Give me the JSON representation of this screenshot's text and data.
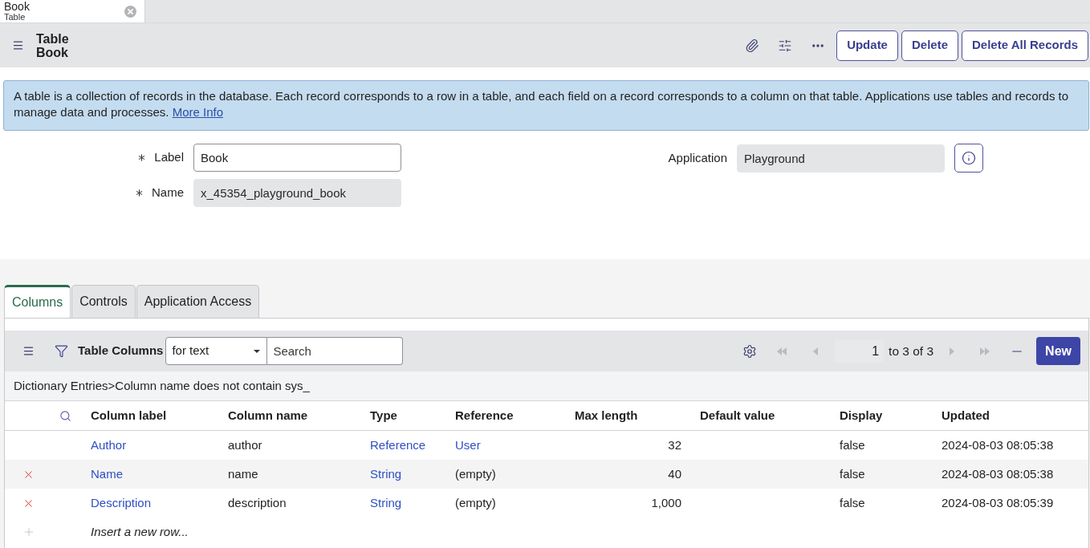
{
  "browser_tabs": [
    {
      "title": "Book",
      "subtitle": "Table",
      "selected": true
    }
  ],
  "header": {
    "title": "Table",
    "subtitle": "Book",
    "buttons": [
      "Update",
      "Delete",
      "Delete All Records"
    ]
  },
  "info_banner": {
    "text": "A table is a collection of records in the database. Each record corresponds to a row in a table, and each field on a record corresponds to a column on that table. Applications use tables and records to manage data and processes.",
    "link": "More Info"
  },
  "form": {
    "left_fields": [
      {
        "label": "Label",
        "required": true,
        "value": "Book",
        "readonly": false
      },
      {
        "label": "Name",
        "required": true,
        "value": "x_45354_playground_book",
        "readonly": true
      }
    ],
    "right_fields": [
      {
        "label": "Application",
        "required": false,
        "value": "Playground",
        "readonly": true
      }
    ]
  },
  "related_tabs": [
    {
      "label": "Columns",
      "selected": true
    },
    {
      "label": "Controls",
      "selected": false
    },
    {
      "label": "Application Access",
      "selected": false
    }
  ],
  "list": {
    "title": "Table Columns",
    "filter_select": "for text",
    "search": {
      "placeholder": "Search"
    },
    "nav_buttons": [
      {
        "kind": "first",
        "disabled": true
      },
      {
        "kind": "previous",
        "disabled": true
      },
      {
        "kind": "next",
        "disabled": true
      },
      {
        "kind": "last",
        "disabled": true
      }
    ],
    "pagination": {
      "page": "1",
      "range": "to 3 of 3"
    },
    "new_button": "New",
    "breadcrumb": "Dictionary Entries>Column name does not contain sys_",
    "columns": [
      "Column label",
      "Column name",
      "Type",
      "Reference",
      "Max length",
      "Default value",
      "Display",
      "Updated"
    ],
    "rows": [
      {
        "deletable": false,
        "column_label": "Author",
        "column_name": "author",
        "type": "Reference",
        "reference": "User",
        "reference_linked": true,
        "max_length": "32",
        "display": "false",
        "updated": "2024-08-03 08:05:38"
      },
      {
        "deletable": true,
        "column_label": "Name",
        "column_name": "name",
        "type": "String",
        "reference": "(empty)",
        "reference_linked": false,
        "max_length": "40",
        "display": "false",
        "updated": "2024-08-03 08:05:38"
      },
      {
        "deletable": true,
        "column_label": "Description",
        "column_name": "description",
        "type": "String",
        "reference": "(empty)",
        "reference_linked": false,
        "max_length": "1,000",
        "display": "false",
        "updated": "2024-08-03 08:05:39"
      }
    ],
    "insert_row": "Insert a new row..."
  }
}
